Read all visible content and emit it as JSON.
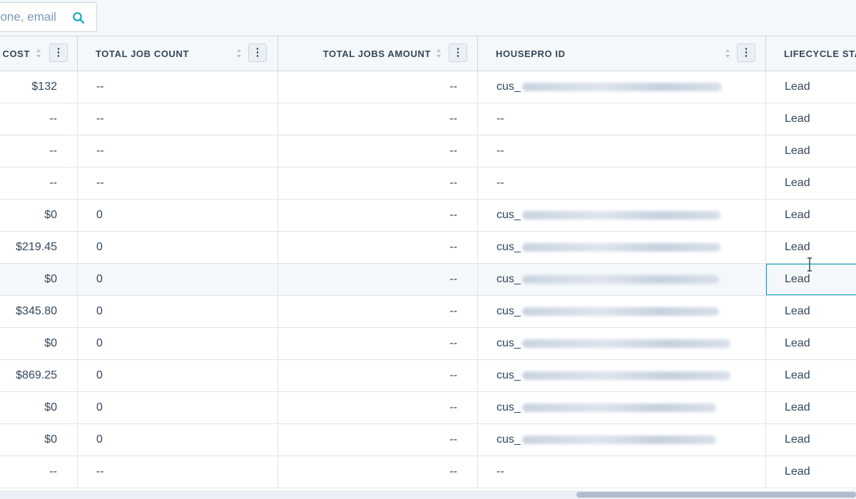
{
  "search": {
    "placeholder": "hone, email"
  },
  "columns": [
    {
      "label": "E COST",
      "has_sort": true,
      "has_menu": true
    },
    {
      "label": "TOTAL JOB COUNT",
      "has_sort": true,
      "has_menu": true
    },
    {
      "label": "TOTAL JOBS AMOUNT",
      "has_sort": true,
      "has_menu": true
    },
    {
      "label": "HOUSEPRO ID",
      "has_sort": true,
      "has_menu": true
    },
    {
      "label": "LIFECYCLE STA",
      "has_sort": false,
      "has_menu": false
    }
  ],
  "rows": [
    {
      "cost": "$132",
      "job_count": "--",
      "jobs_amount": "--",
      "housepro_id": "cus_",
      "id_blurred": true,
      "lifecycle": "Lead"
    },
    {
      "cost": "--",
      "job_count": "--",
      "jobs_amount": "--",
      "housepro_id": "--",
      "id_blurred": false,
      "lifecycle": "Lead"
    },
    {
      "cost": "--",
      "job_count": "--",
      "jobs_amount": "--",
      "housepro_id": "--",
      "id_blurred": false,
      "lifecycle": "Lead"
    },
    {
      "cost": "--",
      "job_count": "--",
      "jobs_amount": "--",
      "housepro_id": "--",
      "id_blurred": false,
      "lifecycle": "Lead"
    },
    {
      "cost": "$0",
      "job_count": "0",
      "jobs_amount": "--",
      "housepro_id": "cus_",
      "id_blurred": true,
      "lifecycle": "Lead"
    },
    {
      "cost": "$219.45",
      "job_count": "0",
      "jobs_amount": "--",
      "housepro_id": "cus_",
      "id_blurred": true,
      "lifecycle": "Lead"
    },
    {
      "cost": "$0",
      "job_count": "0",
      "jobs_amount": "--",
      "housepro_id": "cus_",
      "id_blurred": true,
      "lifecycle": "Lead",
      "hovered": true
    },
    {
      "cost": "$345.80",
      "job_count": "0",
      "jobs_amount": "--",
      "housepro_id": "cus_",
      "id_blurred": true,
      "lifecycle": "Lead"
    },
    {
      "cost": "$0",
      "job_count": "0",
      "jobs_amount": "--",
      "housepro_id": "cus_",
      "id_blurred": true,
      "lifecycle": "Lead"
    },
    {
      "cost": "$869.25",
      "job_count": "0",
      "jobs_amount": "--",
      "housepro_id": "cus_",
      "id_blurred": true,
      "lifecycle": "Lead"
    },
    {
      "cost": "$0",
      "job_count": "0",
      "jobs_amount": "--",
      "housepro_id": "cus_",
      "id_blurred": true,
      "lifecycle": "Lead"
    },
    {
      "cost": "$0",
      "job_count": "0",
      "jobs_amount": "--",
      "housepro_id": "cus_",
      "id_blurred": true,
      "lifecycle": "Lead"
    },
    {
      "cost": "--",
      "job_count": "--",
      "jobs_amount": "--",
      "housepro_id": "--",
      "id_blurred": false,
      "lifecycle": "Lead"
    }
  ],
  "icons": {
    "search": "search-icon",
    "menu": "vertical-dots-icon",
    "sort": "sort-arrows-icon",
    "cursor": "text-cursor-icon"
  },
  "colors": {
    "accent": "#00a4bd",
    "header_bg": "#f5f8fa",
    "border": "#cbd6e2",
    "text": "#33475b"
  }
}
